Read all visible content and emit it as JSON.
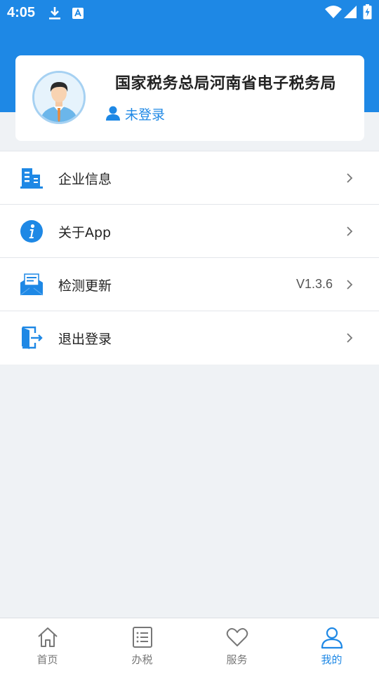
{
  "status_bar": {
    "time": "4:05",
    "icons": [
      "download-icon",
      "font-icon",
      "wifi-icon",
      "signal-icon",
      "battery-charging-icon"
    ]
  },
  "profile": {
    "org_name": "国家税务总局河南省电子税务局",
    "login_status": "未登录",
    "avatar_icon": "user-avatar-icon",
    "status_icon": "person-icon"
  },
  "menu": {
    "items": [
      {
        "label": "企业信息",
        "value": "",
        "icon": "building-icon"
      },
      {
        "label": "关于App",
        "value": "",
        "icon": "info-icon"
      },
      {
        "label": "检测更新",
        "value": "V1.3.6",
        "icon": "mail-update-icon"
      },
      {
        "label": "退出登录",
        "value": "",
        "icon": "logout-icon"
      }
    ]
  },
  "tab_bar": {
    "tabs": [
      {
        "label": "首页",
        "icon": "home-icon",
        "active": false
      },
      {
        "label": "办税",
        "icon": "list-icon",
        "active": false
      },
      {
        "label": "服务",
        "icon": "heart-icon",
        "active": false
      },
      {
        "label": "我的",
        "icon": "profile-icon",
        "active": true
      }
    ]
  },
  "colors": {
    "primary": "#1e88e5",
    "background": "#eff2f5",
    "inactive_tab": "#777777"
  }
}
